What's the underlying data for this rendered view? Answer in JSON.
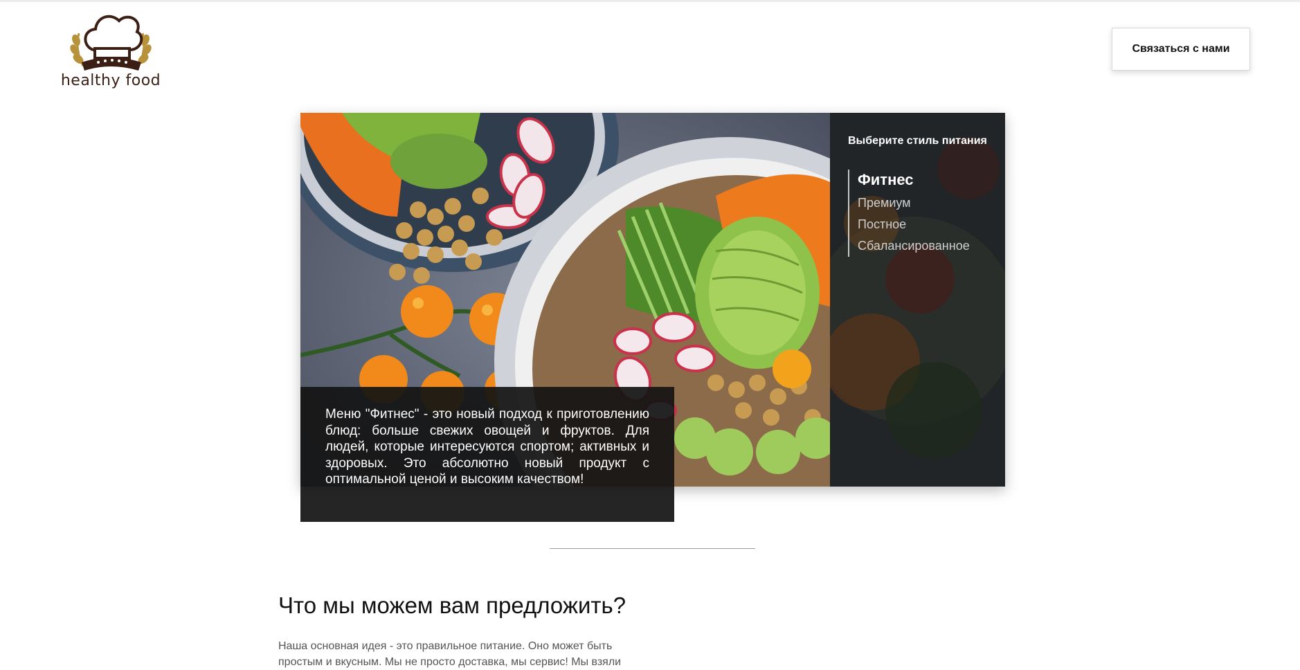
{
  "header": {
    "logo_text": "healthy food",
    "contact_button": "Связаться с нами"
  },
  "hero": {
    "menu_title": "Выберите стиль питания",
    "menu_items": [
      {
        "label": "Фитнес",
        "active": true
      },
      {
        "label": "Премиум",
        "active": false
      },
      {
        "label": "Постное",
        "active": false
      },
      {
        "label": "Сбалансированное",
        "active": false
      }
    ],
    "description": "Меню \"Фитнес\" - это новый подход к приготовлению блюд: больше свежих овощей и фруктов. Для людей, которые интересуются спортом; активных и здоровых. Это абсолютно новый продукт с оптимальной ценой и высоким качеством!"
  },
  "section": {
    "title": "Что мы можем вам предложить?",
    "text": "Наша основная идея - это правильное питание. Оно может быть простым и вкусным. Мы не просто доставка, мы сервис! Мы взяли"
  },
  "colors": {
    "logo_brown": "#3b1f14",
    "logo_gold": "#b8923a",
    "overlay_dark": "#141414"
  }
}
